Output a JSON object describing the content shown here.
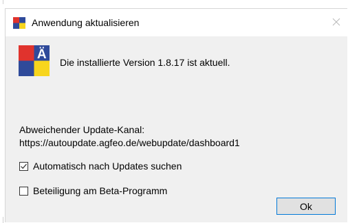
{
  "window": {
    "title": "Anwendung aktualisieren",
    "close_icon": "close-icon"
  },
  "app_icon": {
    "letter": "Ä",
    "colors": {
      "top_left": "#e0332d",
      "top_right": "#2f4a9a",
      "bottom_left": "#2f4a9a",
      "bottom_right": "#f7d51d"
    }
  },
  "status": {
    "message": "Die installierte Version 1.8.17 ist aktuell."
  },
  "update_channel": {
    "label": "Abweichender Update-Kanal:",
    "url": "https://autoupdate.agfeo.de/webupdate/dashboard1"
  },
  "options": {
    "auto_check": {
      "label": "Automatisch nach Updates suchen",
      "checked": true
    },
    "beta": {
      "label": "Beteiligung am Beta-Programm",
      "checked": false
    }
  },
  "buttons": {
    "ok_label": "Ok"
  },
  "colors": {
    "accent": "#0078d7",
    "dialog_bg": "#f0f0f0",
    "titlebar_bg": "#ffffff"
  }
}
